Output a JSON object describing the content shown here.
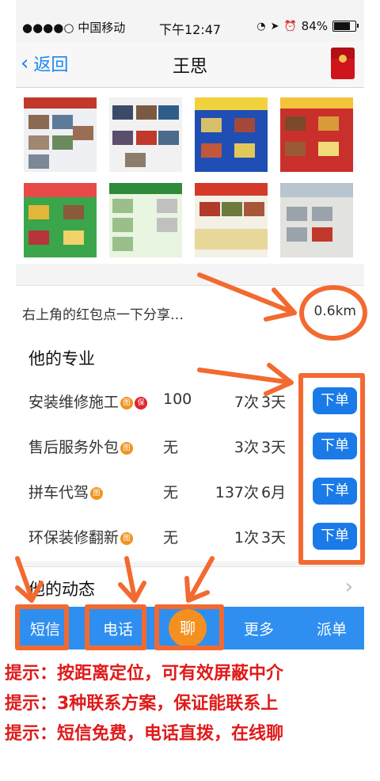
{
  "status_bar": {
    "carrier": "●●●●○ 中国移动",
    "time": "下午12:47",
    "battery": "84%",
    "battery_level": 0.84
  },
  "nav": {
    "back_label": "返回",
    "title": "王思"
  },
  "location": {
    "text": "右上角的红包点一下分享…",
    "distance": "0.6km"
  },
  "profession": {
    "heading": "他的专业",
    "rows": [
      {
        "name": "安装维修施工",
        "badges": [
          "图",
          "保"
        ],
        "col1": "100",
        "col2": "7次",
        "col3": "3天",
        "button": "下单"
      },
      {
        "name": "售后服务外包",
        "badges": [
          "图"
        ],
        "col1": "无",
        "col2": "3次",
        "col3": "3天",
        "button": "下单"
      },
      {
        "name": "拼车代驾",
        "badges": [
          "图"
        ],
        "col1": "无",
        "col2": "137次",
        "col3": "6月",
        "button": "下单"
      },
      {
        "name": "环保装修翻新",
        "badges": [
          "图"
        ],
        "col1": "无",
        "col2": "1次",
        "col3": "3天",
        "button": "下单"
      }
    ]
  },
  "dynamics": {
    "label": "他的动态"
  },
  "bottom_bar": {
    "sms": "短信",
    "phone": "电话",
    "chat": "聊",
    "more": "更多",
    "dispatch": "派单"
  },
  "tips": [
    "提示：按距离定位，可有效屏蔽中介",
    "提示：3种联系方案，保证能联系上",
    "提示：短信免费，电话直拨，在线聊"
  ],
  "colors": {
    "accent_blue": "#1a7ae8",
    "bar_blue": "#2f8ff0",
    "annotation_orange": "#f26a30",
    "tip_red": "#e01a1a"
  }
}
